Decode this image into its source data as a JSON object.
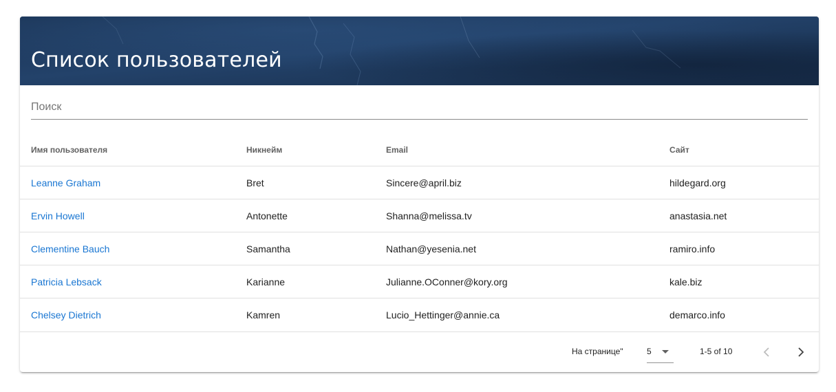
{
  "header": {
    "title": "Список пользователей"
  },
  "search": {
    "placeholder": "Поиск",
    "value": ""
  },
  "table": {
    "columns": {
      "name": "Имя пользователя",
      "nickname": "Никнейм",
      "email": "Email",
      "site": "Сайт"
    },
    "rows": [
      {
        "name": "Leanne Graham",
        "nickname": "Bret",
        "email": "Sincere@april.biz",
        "site": "hildegard.org"
      },
      {
        "name": "Ervin Howell",
        "nickname": "Antonette",
        "email": "Shanna@melissa.tv",
        "site": "anastasia.net"
      },
      {
        "name": "Clementine Bauch",
        "nickname": "Samantha",
        "email": "Nathan@yesenia.net",
        "site": "ramiro.info"
      },
      {
        "name": "Patricia Lebsack",
        "nickname": "Karianne",
        "email": "Julianne.OConner@kory.org",
        "site": "kale.biz"
      },
      {
        "name": "Chelsey Dietrich",
        "nickname": "Kamren",
        "email": "Lucio_Hettinger@annie.ca",
        "site": "demarco.info"
      }
    ]
  },
  "pagination": {
    "rows_per_page_label": "На странице\"",
    "rows_per_page_value": "5",
    "range_label": "1-5 of 10",
    "prev_icon": "chevron-left-icon",
    "next_icon": "chevron-right-icon",
    "dropdown_icon": "caret-down-icon"
  },
  "colors": {
    "header_bg": "#1d3658",
    "link": "#1976d2",
    "text": "#212121",
    "muted": "#616161",
    "divider": "#e0e0e0"
  }
}
